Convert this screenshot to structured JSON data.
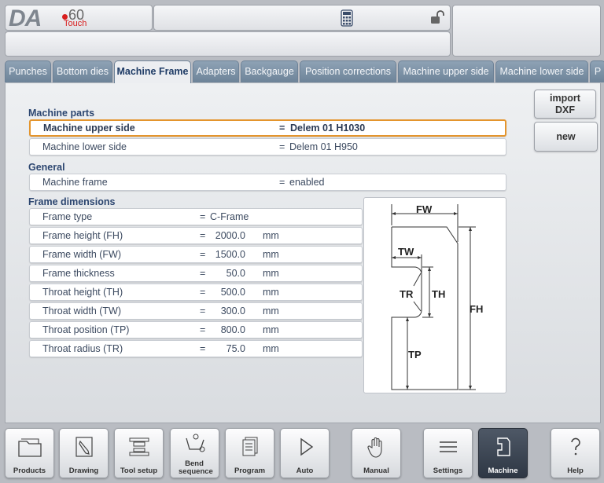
{
  "logo": {
    "brand": "DA",
    "model": "60",
    "variant": "Touch"
  },
  "tabs": [
    {
      "label": "Punches",
      "active": false
    },
    {
      "label": "Bottom dies",
      "active": false
    },
    {
      "label": "Machine Frame",
      "active": true
    },
    {
      "label": "Adapters",
      "active": false
    },
    {
      "label": "Backgauge",
      "active": false
    },
    {
      "label": "Position corrections",
      "active": false
    },
    {
      "label": "Machine upper side",
      "active": false
    },
    {
      "label": "Machine lower side",
      "active": false
    },
    {
      "label": "P",
      "active": false
    }
  ],
  "sections": {
    "machine_parts": "Machine parts",
    "general": "General",
    "frame_dimensions": "Frame dimensions"
  },
  "machine_parts": [
    {
      "label": "Machine upper side",
      "eq": "=",
      "value": "Delem 01 H1030",
      "selected": true
    },
    {
      "label": "Machine lower side",
      "eq": "=",
      "value": "Delem 01 H950",
      "selected": false
    }
  ],
  "general": [
    {
      "label": "Machine frame",
      "eq": "=",
      "value": "enabled"
    }
  ],
  "frame_dimensions": [
    {
      "label": "Frame type",
      "eq": "=",
      "value": "C-Frame",
      "unit": ""
    },
    {
      "label": "Frame height (FH)",
      "eq": "=",
      "value": "2000.0",
      "unit": "mm"
    },
    {
      "label": "Frame width (FW)",
      "eq": "=",
      "value": "1500.0",
      "unit": "mm"
    },
    {
      "label": "Frame thickness",
      "eq": "=",
      "value": "50.0",
      "unit": "mm"
    },
    {
      "label": "Throat height (TH)",
      "eq": "=",
      "value": "500.0",
      "unit": "mm"
    },
    {
      "label": "Throat width (TW)",
      "eq": "=",
      "value": "300.0",
      "unit": "mm"
    },
    {
      "label": "Throat position (TP)",
      "eq": "=",
      "value": "800.0",
      "unit": "mm"
    },
    {
      "label": "Throat radius (TR)",
      "eq": "=",
      "value": "75.0",
      "unit": "mm"
    }
  ],
  "side_buttons": {
    "import_line1": "import",
    "import_line2": "DXF",
    "new": "new"
  },
  "diagram": {
    "fw": "FW",
    "tw": "TW",
    "tr": "TR",
    "th": "TH",
    "fh": "FH",
    "tp": "TP"
  },
  "bottom_nav": [
    {
      "label": "Products",
      "icon": "folder-icon",
      "active": false
    },
    {
      "label": "Drawing",
      "icon": "pencil-icon",
      "active": false
    },
    {
      "label": "Tool setup",
      "icon": "tool-setup-icon",
      "active": false
    },
    {
      "label": "Bend sequence",
      "icon": "bend-sequence-icon",
      "active": false
    },
    {
      "label": "Program",
      "icon": "pages-icon",
      "active": false
    },
    {
      "label": "Auto",
      "icon": "play-icon",
      "active": false
    },
    {
      "label": "Manual",
      "icon": "hand-icon",
      "active": false
    },
    {
      "label": "Settings",
      "icon": "list-icon",
      "active": false
    },
    {
      "label": "Machine",
      "icon": "machine-frame-icon",
      "active": true
    },
    {
      "label": "Help",
      "icon": "question-icon",
      "active": false
    }
  ]
}
